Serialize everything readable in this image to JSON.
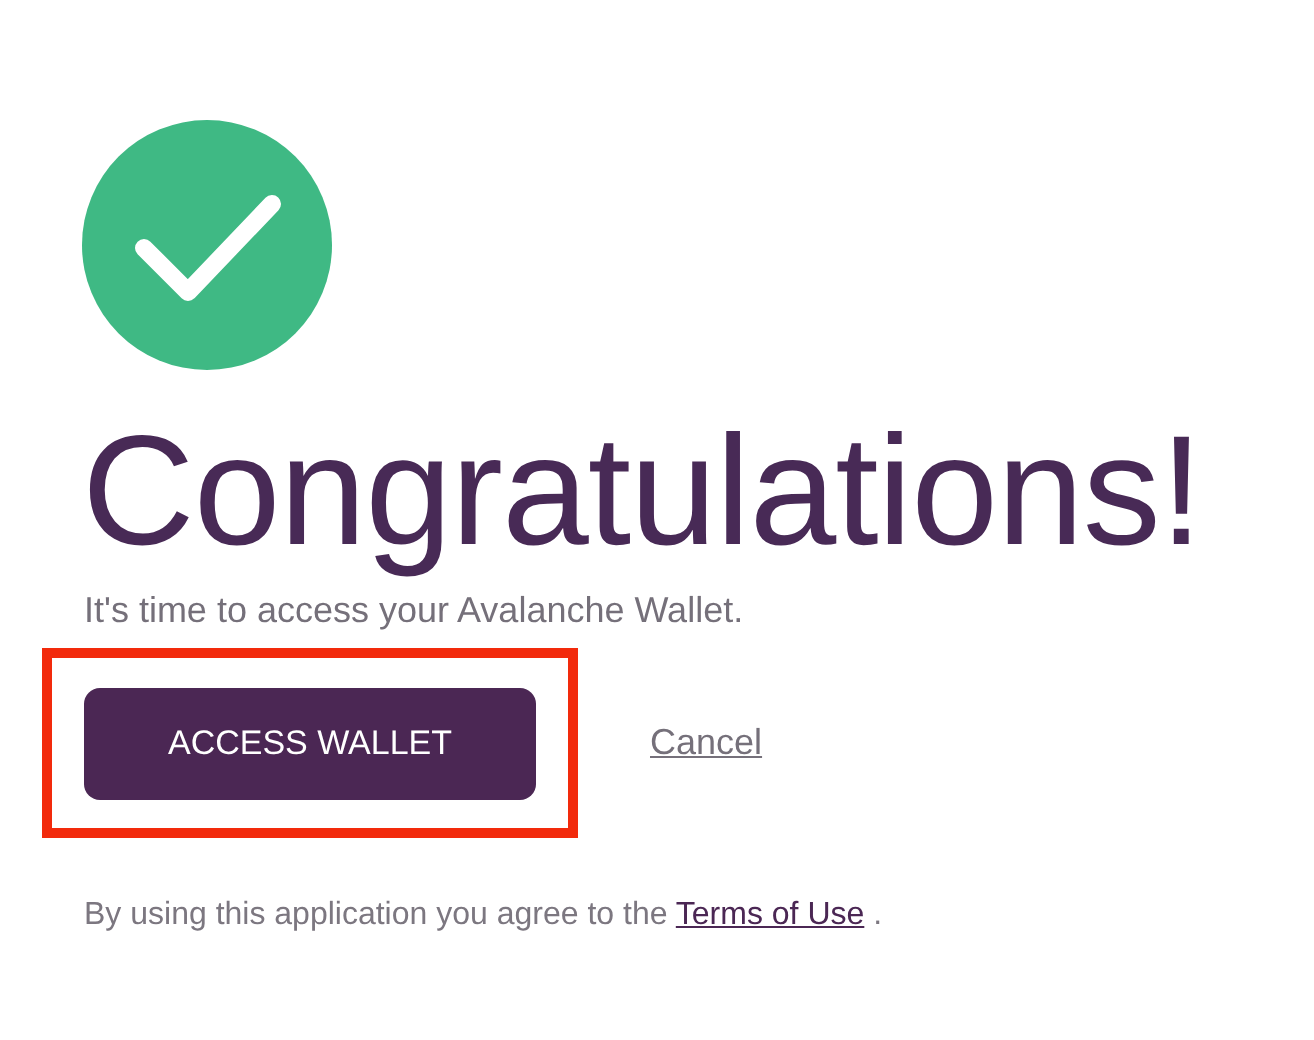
{
  "status_icon": {
    "kind": "success"
  },
  "heading": "Congratulations!",
  "subtitle": "It's time to access your Avalanche Wallet.",
  "actions": {
    "primary": {
      "label": "ACCESS WALLET",
      "highlighted": true
    },
    "secondary": {
      "label": "Cancel"
    }
  },
  "footer": {
    "text_before": "By using this application you agree to the ",
    "link": "Terms of Use",
    "text_after": " ."
  }
}
